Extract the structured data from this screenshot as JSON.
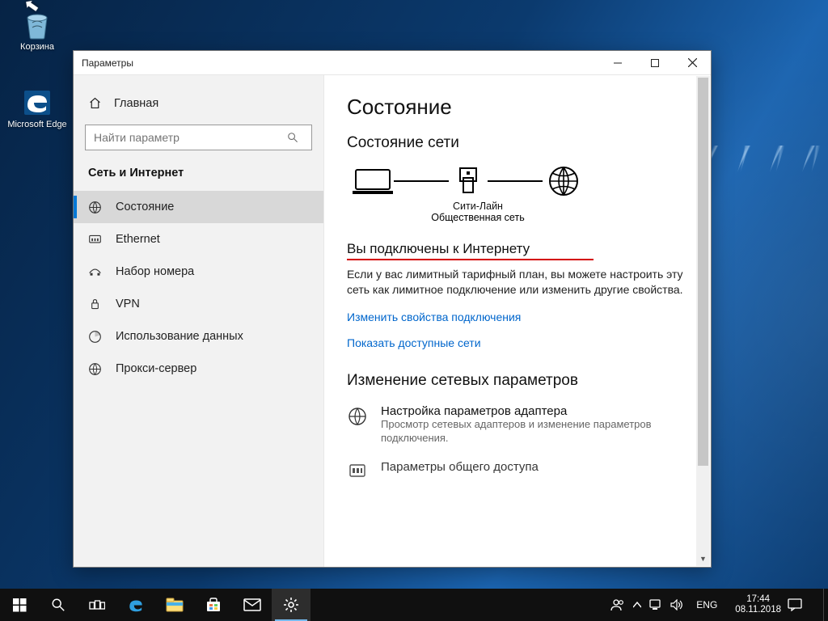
{
  "desktop": {
    "icons": [
      {
        "name": "recycle-bin",
        "label": "Корзина"
      },
      {
        "name": "microsoft-edge",
        "label": "Microsoft Edge"
      }
    ]
  },
  "window": {
    "title": "Параметры",
    "sidebar": {
      "home_label": "Главная",
      "search_placeholder": "Найти параметр",
      "section": "Сеть и Интернет",
      "items": [
        {
          "label": "Состояние",
          "selected": true
        },
        {
          "label": "Ethernet",
          "selected": false
        },
        {
          "label": "Набор номера",
          "selected": false
        },
        {
          "label": "VPN",
          "selected": false
        },
        {
          "label": "Использование данных",
          "selected": false
        },
        {
          "label": "Прокси-сервер",
          "selected": false
        }
      ]
    },
    "content": {
      "heading": "Состояние",
      "net_heading": "Состояние сети",
      "network_name": "Сити-Лайн",
      "network_type": "Общественная сеть",
      "connected_heading": "Вы подключены к Интернету",
      "connected_desc": "Если у вас лимитный тарифный план, вы можете настроить эту сеть как лимитное подключение или изменить другие свойства.",
      "link_change": "Изменить свойства подключения",
      "link_show": "Показать доступные сети",
      "change_heading": "Изменение сетевых параметров",
      "adapter_title": "Настройка параметров адаптера",
      "adapter_desc": "Просмотр сетевых адаптеров и изменение параметров подключения.",
      "sharing_title": "Параметры общего доступа"
    }
  },
  "taskbar": {
    "lang": "ENG",
    "time": "17:44",
    "date": "08.11.2018"
  }
}
